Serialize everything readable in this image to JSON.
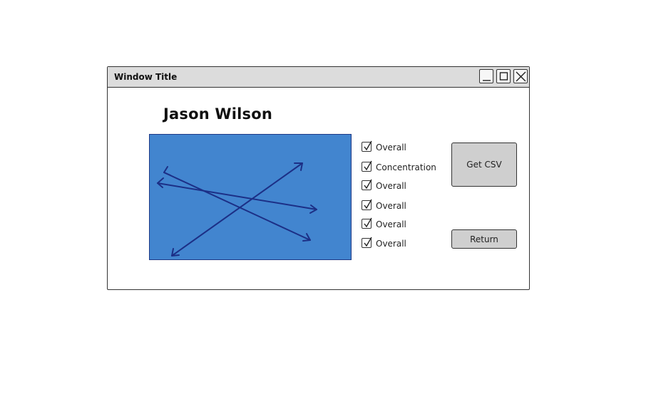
{
  "window": {
    "title": "Window Title"
  },
  "main": {
    "heading": "Jason Wilson"
  },
  "checkboxes": [
    {
      "label": "Overall",
      "checked": true
    },
    {
      "label": "Concentration",
      "checked": true
    },
    {
      "label": "Overall",
      "checked": true
    },
    {
      "label": "Overall",
      "checked": true
    },
    {
      "label": "Overall",
      "checked": true
    },
    {
      "label": "Overall",
      "checked": true
    }
  ],
  "buttons": {
    "get_csv": "Get CSV",
    "return": "Return"
  },
  "colors": {
    "image_fill": "#4285cf",
    "image_stroke": "#1f3a86",
    "titlebar": "#dcdcdc",
    "button": "#cfcfcf"
  },
  "icons": {
    "minimize": "minimize-icon",
    "maximize": "maximize-icon",
    "close": "close-icon",
    "checkmark": "checkmark-icon"
  }
}
